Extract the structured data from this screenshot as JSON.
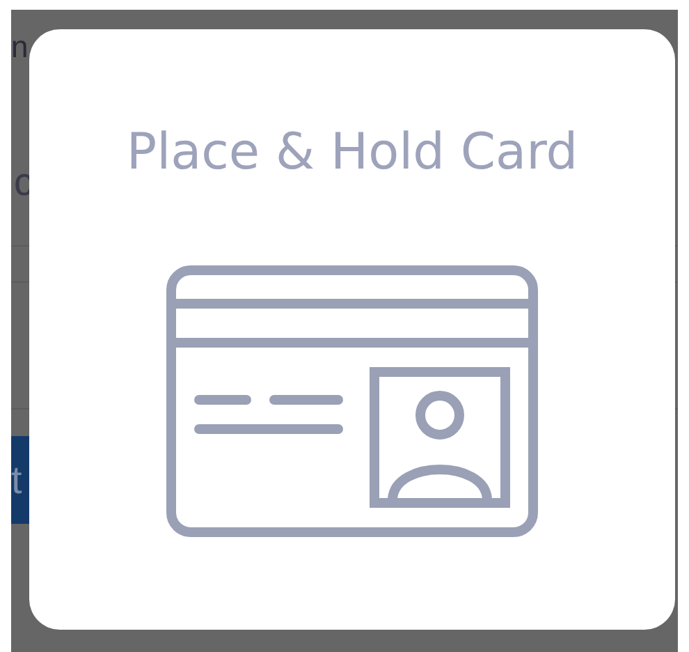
{
  "background": {
    "heading_fragment": "n",
    "row_fragment": "c",
    "button_fragment": "t"
  },
  "dialog": {
    "title": "Place & Hold Card"
  }
}
